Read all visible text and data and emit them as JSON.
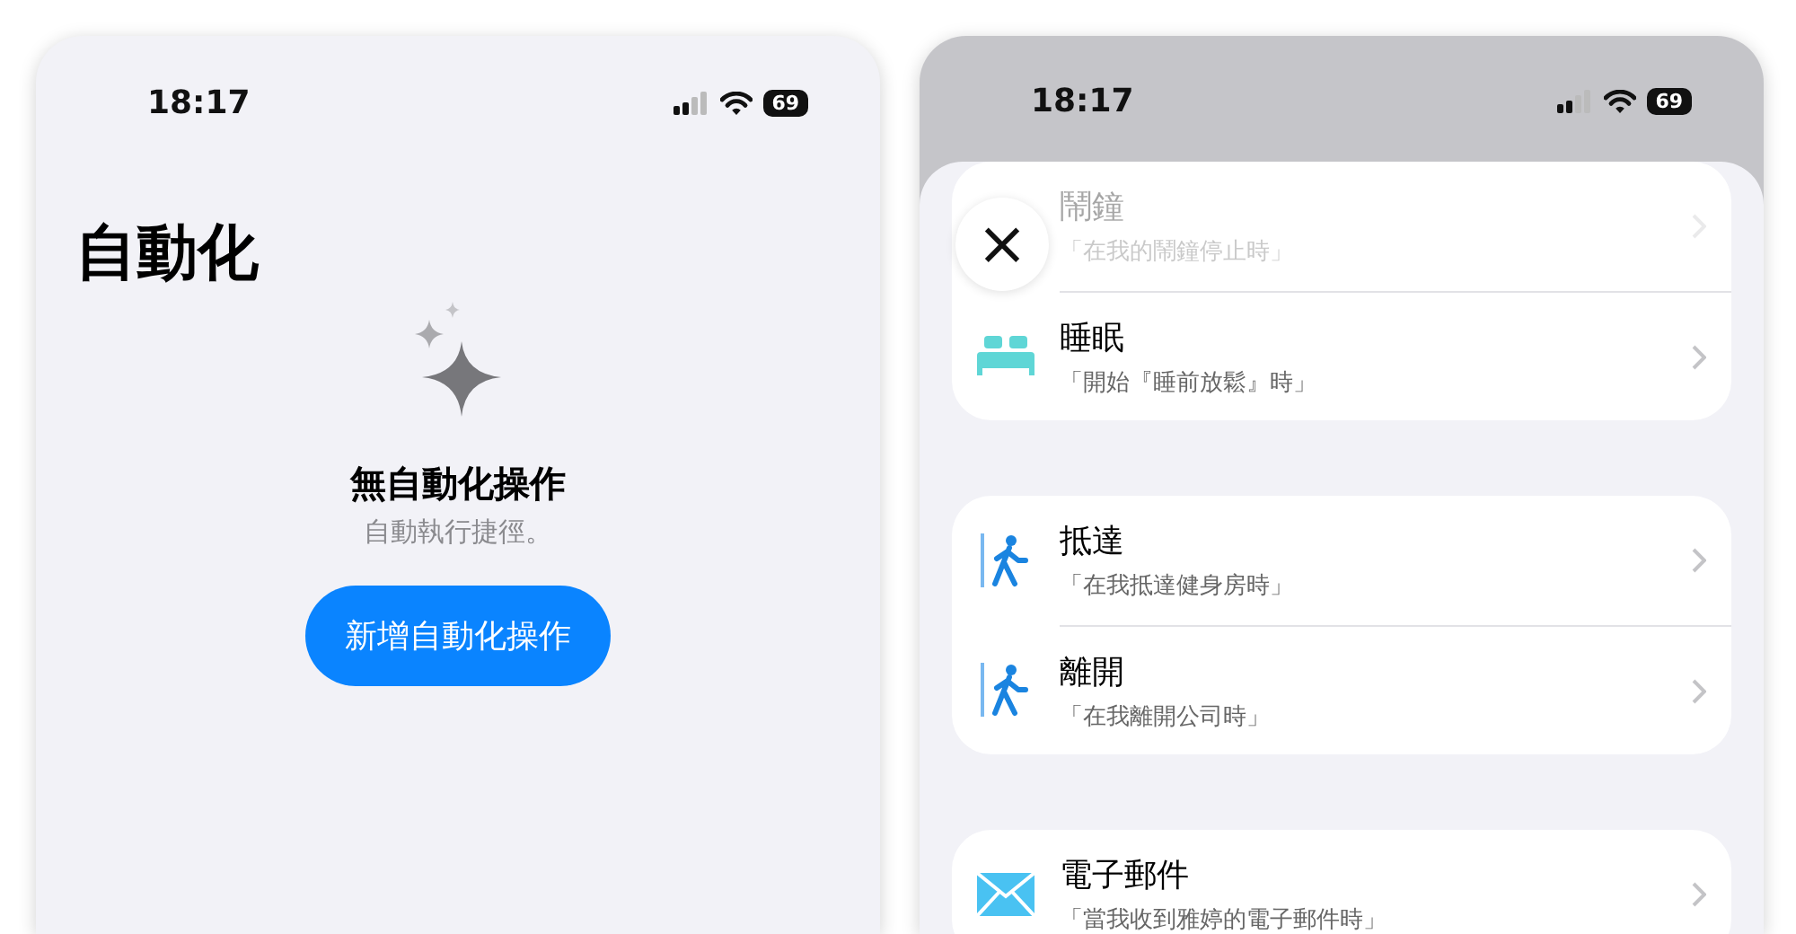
{
  "left_screen": {
    "status_bar": {
      "time": "18:17",
      "battery": "69"
    },
    "title": "自動化",
    "empty_state": {
      "heading": "無自動化操作",
      "subtitle": "自動執行捷徑。"
    },
    "add_button": "新增自動化操作"
  },
  "right_screen": {
    "status_bar": {
      "time": "18:17",
      "battery": "69"
    },
    "close_button": "×",
    "groups": [
      {
        "items": [
          {
            "kind": "alarm",
            "title": "鬧鐘",
            "subtitle": "「在我的鬧鐘停止時」",
            "dimmed": true
          },
          {
            "kind": "sleep",
            "title": "睡眠",
            "subtitle": "「開始『睡前放鬆』時」",
            "dimmed": false
          }
        ]
      },
      {
        "items": [
          {
            "kind": "arrive",
            "title": "抵達",
            "subtitle": "「在我抵達健身房時」",
            "dimmed": false
          },
          {
            "kind": "leave",
            "title": "離開",
            "subtitle": "「在我離開公司時」",
            "dimmed": false
          }
        ]
      },
      {
        "items": [
          {
            "kind": "mail",
            "title": "電子郵件",
            "subtitle": "「當我收到雅婷的電子郵件時」",
            "dimmed": false
          }
        ]
      }
    ]
  }
}
